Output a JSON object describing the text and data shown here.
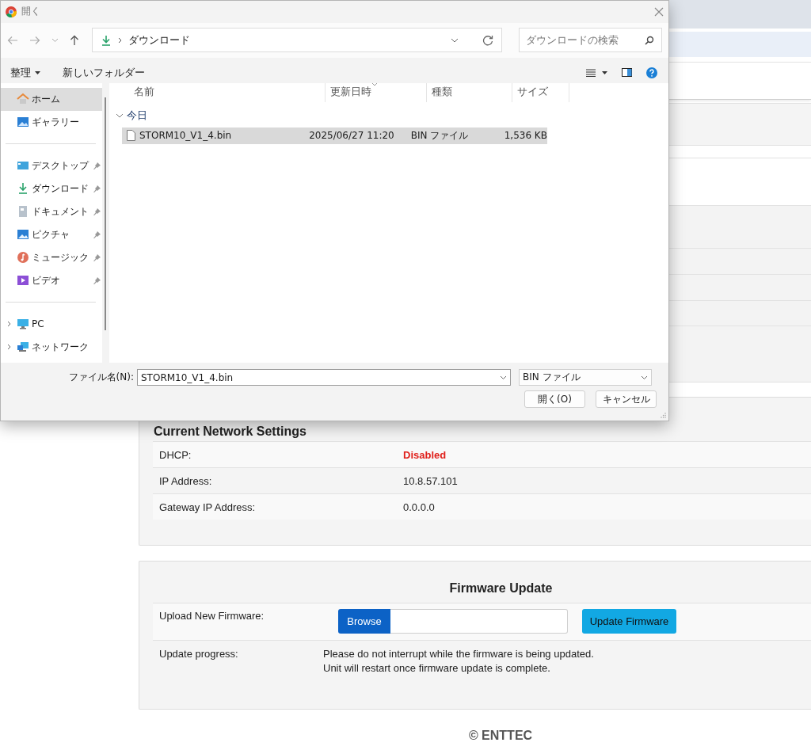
{
  "dialog": {
    "title": "開く",
    "breadcrumb": "ダウンロード",
    "search_placeholder": "ダウンロードの検索",
    "toolbar": {
      "organize": "整理",
      "new_folder": "新しいフォルダー"
    },
    "sidebar": {
      "sections": [
        {
          "items": [
            {
              "label": "ホーム",
              "kind": "home",
              "selected": true,
              "pinned": false,
              "expandable": false
            },
            {
              "label": "ギャラリー",
              "kind": "gallery",
              "selected": false,
              "pinned": false,
              "expandable": false
            }
          ]
        },
        {
          "items": [
            {
              "label": "デスクトップ",
              "kind": "desktop",
              "selected": false,
              "pinned": true,
              "expandable": false
            },
            {
              "label": "ダウンロード",
              "kind": "download",
              "selected": false,
              "pinned": true,
              "expandable": false
            },
            {
              "label": "ドキュメント",
              "kind": "document",
              "selected": false,
              "pinned": true,
              "expandable": false
            },
            {
              "label": "ピクチャ",
              "kind": "pictures",
              "selected": false,
              "pinned": true,
              "expandable": false
            },
            {
              "label": "ミュージック",
              "kind": "music",
              "selected": false,
              "pinned": true,
              "expandable": false
            },
            {
              "label": "ビデオ",
              "kind": "video",
              "selected": false,
              "pinned": true,
              "expandable": false
            }
          ]
        },
        {
          "items": [
            {
              "label": "PC",
              "kind": "pc",
              "selected": false,
              "pinned": false,
              "expandable": true
            },
            {
              "label": "ネットワーク",
              "kind": "network",
              "selected": false,
              "pinned": false,
              "expandable": true
            }
          ]
        }
      ]
    },
    "columns": [
      {
        "label": "名前",
        "sorted": false
      },
      {
        "label": "更新日時",
        "sorted": true
      },
      {
        "label": "種類",
        "sorted": false
      },
      {
        "label": "サイズ",
        "sorted": false
      }
    ],
    "group": {
      "label": "今日",
      "expanded": true
    },
    "files": [
      {
        "name": "STORM10_V1_4.bin",
        "modified": "2025/06/27 11:20",
        "type": "BIN ファイル",
        "size": "1,536 KB",
        "selected": true
      }
    ],
    "filename_label": "ファイル名(N):",
    "filename": "STORM10_V1_4.bin",
    "filetype": "BIN ファイル",
    "buttons": [
      "開く(O)",
      "キャンセル"
    ]
  },
  "network": {
    "title": "Current Network Settings",
    "rows": [
      {
        "label": "DHCP:",
        "value": "Disabled",
        "kind": "alert"
      },
      {
        "label": "IP Address:",
        "value": "10.8.57.101",
        "kind": "plain"
      },
      {
        "label": "Gateway IP Address:",
        "value": "0.0.0.0",
        "kind": "plain"
      }
    ]
  },
  "firmware": {
    "title": "Firmware Update",
    "upload_label": "Upload New Firmware:",
    "browse": "Browse",
    "update_button": "Update Firmware",
    "progress_label": "Update progress:",
    "progress_lines": [
      "Please do not interrupt while the firmware is being updated.",
      "Unit will restart once firmware update is complete."
    ]
  },
  "footer": "© ENTTEC"
}
